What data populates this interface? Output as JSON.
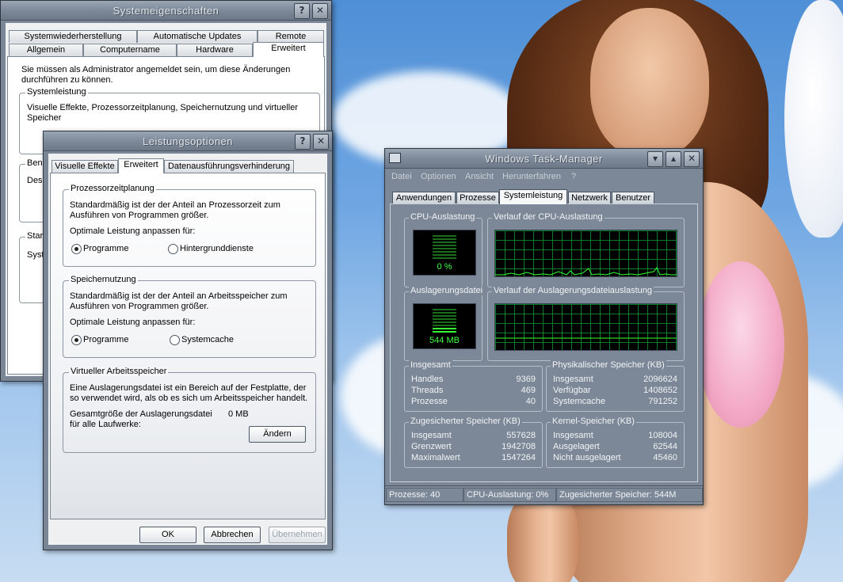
{
  "system_properties": {
    "title": "Systemeigenschaften",
    "tabs_row1": [
      "Systemwiederherstellung",
      "Automatische Updates",
      "Remote"
    ],
    "tabs_row2": [
      "Allgemein",
      "Computername",
      "Hardware",
      "Erweitert"
    ],
    "active_tab": "Erweitert",
    "admin_notice_line1": "Sie müssen als Administrator angemeldet sein, um diese Änderungen",
    "admin_notice_line2": "durchführen zu können.",
    "group_performance": "Systemleistung",
    "performance_text_line1": "Visuelle Effekte, Prozessorzeitplanung, Speichernutzung und virtueller",
    "performance_text_line2": "Speicher",
    "group_user_partial": "Bene",
    "user_text_partial": "Desk",
    "group_start_partial": "Start",
    "start_text_partial": "Syst"
  },
  "performance_options": {
    "title": "Leistungsoptionen",
    "tabs": [
      "Visuelle Effekte",
      "Erweitert",
      "Datenausführungsverhinderung"
    ],
    "active_tab": "Erweitert",
    "cpu_group": {
      "legend": "Prozessorzeitplanung",
      "desc_line1": "Standardmäßig ist der der Anteil an Prozessorzeit zum",
      "desc_line2": "Ausführen von Programmen größer.",
      "adjust_label": "Optimale Leistung anpassen für:",
      "option_programs": "Programme",
      "option_services": "Hintergrunddienste",
      "selected": "Programme"
    },
    "memory_group": {
      "legend": "Speichernutzung",
      "desc_line1": "Standardmäßig ist der der Anteil an Arbeitsspeicher zum",
      "desc_line2": "Ausführen von Programmen größer.",
      "adjust_label": "Optimale Leistung anpassen für:",
      "option_programs": "Programme",
      "option_cache": "Systemcache",
      "selected": "Programme"
    },
    "virtual_group": {
      "legend": "Virtueller Arbeitsspeicher",
      "desc_line1": "Eine Auslagerungsdatei ist ein Bereich auf der Festplatte, der",
      "desc_line2": "so verwendet wird, als ob es sich um Arbeitsspeicher handelt.",
      "total_label_line1": "Gesamtgröße der Auslagerungsdatei",
      "total_label_line2": "für alle Laufwerke:",
      "total_value": "0 MB",
      "change_button": "Ändern"
    },
    "ok_button": "OK",
    "cancel_button": "Abbrechen",
    "apply_button": "Übernehmen"
  },
  "task_manager": {
    "title": "Windows Task-Manager",
    "menu": [
      "Datei",
      "Optionen",
      "Ansicht",
      "Herunterfahren",
      "?"
    ],
    "tabs": [
      "Anwendungen",
      "Prozesse",
      "Systemleistung",
      "Netzwerk",
      "Benutzer"
    ],
    "active_tab": "Systemleistung",
    "cpu_usage_label": "CPU-Auslastung",
    "cpu_usage_value": "0 %",
    "cpu_usage_fraction": 0.0,
    "cpu_history_label": "Verlauf der CPU-Auslastung",
    "pagefile_label": "Auslagerungsdatei",
    "pagefile_value": "544 MB",
    "pagefile_fraction": 0.26,
    "pagefile_history_label": "Verlauf der Auslagerungsdateiauslastung",
    "totals": {
      "legend": "Insgesamt",
      "rows": [
        {
          "label": "Handles",
          "value": "9369"
        },
        {
          "label": "Threads",
          "value": "469"
        },
        {
          "label": "Prozesse",
          "value": "40"
        }
      ]
    },
    "physical": {
      "legend": "Physikalischer Speicher (KB)",
      "rows": [
        {
          "label": "Insgesamt",
          "value": "2096624"
        },
        {
          "label": "Verfügbar",
          "value": "1408652"
        },
        {
          "label": "Systemcache",
          "value": "791252"
        }
      ]
    },
    "commit": {
      "legend": "Zugesicherter Speicher (KB)",
      "rows": [
        {
          "label": "Insgesamt",
          "value": "557628"
        },
        {
          "label": "Grenzwert",
          "value": "1942708"
        },
        {
          "label": "Maximalwert",
          "value": "1547264"
        }
      ]
    },
    "kernel": {
      "legend": "Kernel-Speicher (KB)",
      "rows": [
        {
          "label": "Insgesamt",
          "value": "108004"
        },
        {
          "label": "Ausgelagert",
          "value": "62544"
        },
        {
          "label": "Nicht ausgelagert",
          "value": "45460"
        }
      ]
    },
    "status_processes": "Prozesse: 40",
    "status_cpu": "CPU-Auslastung: 0%",
    "status_commit": "Zugesicherter Speicher: 544M"
  },
  "icons": {
    "help": "help-icon",
    "close": "close-icon",
    "minimize": "minimize-icon",
    "restore": "restore-icon",
    "app": "task-manager-icon"
  },
  "colors": {
    "graph_line": "#33ff33",
    "graph_grid": "#0b7a2a",
    "window_frame": "#7a8695"
  }
}
